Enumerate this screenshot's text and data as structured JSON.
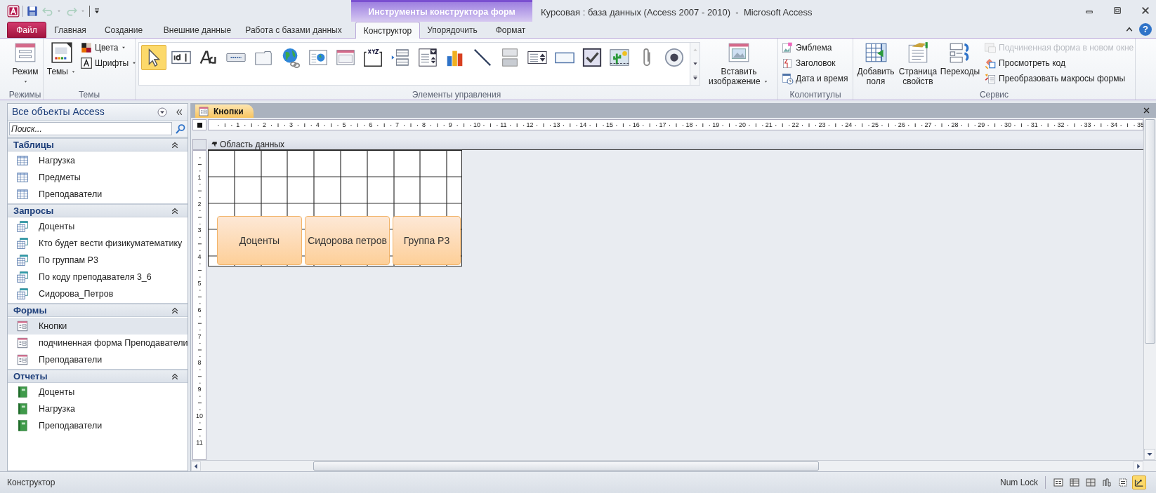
{
  "window": {
    "title": "Курсовая : база данных (Access 2007 - 2010)  -  Microsoft Access",
    "context_title": "Инструменты конструктора форм"
  },
  "quick_access": [
    {
      "disabled": false
    },
    {
      "disabled": true
    },
    {
      "disabled": true
    }
  ],
  "help": "?",
  "ribbon_tabs": [
    {
      "label": "Файл",
      "kind": "file",
      "selected": false
    },
    {
      "label": "Главная",
      "kind": "tab",
      "selected": false
    },
    {
      "label": "Создание",
      "kind": "tab",
      "selected": false
    },
    {
      "label": "Внешние данные",
      "kind": "tab",
      "selected": false
    },
    {
      "label": "Работа с базами данных",
      "kind": "tab",
      "selected": false
    },
    {
      "label": "Конструктор",
      "kind": "tab",
      "selected": true
    },
    {
      "label": "Упорядочить",
      "kind": "tab",
      "selected": false
    },
    {
      "label": "Формат",
      "kind": "tab",
      "selected": false
    }
  ],
  "ribbon_groups": [
    {
      "label": "Режимы",
      "large": [
        {
          "label": "Режим",
          "dropdown": true
        }
      ]
    },
    {
      "label": "Темы",
      "large": [
        {
          "label": "Темы",
          "dropdown": true
        }
      ],
      "small": [
        {
          "label": "Цвета",
          "dropdown": true,
          "disabled": false
        },
        {
          "label": "Шрифты",
          "dropdown": true,
          "disabled": false
        }
      ]
    },
    {
      "label": "Элементы управления",
      "tools": [
        {
          "selected": true
        },
        {
          "selected": false
        },
        {
          "selected": false
        },
        {
          "selected": false
        },
        {
          "selected": false
        },
        {
          "selected": false
        },
        {
          "selected": false
        },
        {
          "selected": false
        },
        {
          "selected": false
        },
        {
          "selected": false
        },
        {
          "selected": false
        },
        {
          "selected": false
        },
        {
          "selected": false
        },
        {
          "selected": false
        },
        {
          "selected": false
        },
        {
          "selected": false
        },
        {
          "selected": false
        },
        {
          "selected": false
        },
        {
          "selected": false
        },
        {
          "selected": false
        }
      ],
      "large": [
        {
          "label": "Вставить изображение",
          "dropdown": true
        }
      ]
    },
    {
      "label": "Колонтитулы",
      "small": [
        {
          "label": "Эмблема",
          "dropdown": false,
          "disabled": false
        },
        {
          "label": "Заголовок",
          "dropdown": false,
          "disabled": false
        },
        {
          "label": "Дата и время",
          "dropdown": false,
          "disabled": false
        }
      ]
    },
    {
      "label": "Сервис",
      "large": [
        {
          "label": "Добавить поля",
          "dropdown": false
        },
        {
          "label": "Страница свойств",
          "dropdown": false
        },
        {
          "label": "Переходы",
          "dropdown": false
        }
      ],
      "small": [
        {
          "label": "Подчиненная форма в новом окне",
          "dropdown": false,
          "disabled": true
        },
        {
          "label": "Просмотреть код",
          "dropdown": false,
          "disabled": false
        },
        {
          "label": "Преобразовать макросы формы",
          "dropdown": false,
          "disabled": false
        }
      ]
    }
  ],
  "nav": {
    "title": "Все объекты Access",
    "search_placeholder": "Поиск...",
    "groups": [
      {
        "label": "Таблицы",
        "expanded": true,
        "items": [
          {
            "label": "Нагрузка",
            "kind": "table",
            "selected": false
          },
          {
            "label": "Предметы",
            "kind": "table",
            "selected": false
          },
          {
            "label": "Преподаватели",
            "kind": "table",
            "selected": false
          }
        ]
      },
      {
        "label": "Запросы",
        "expanded": true,
        "items": [
          {
            "label": "Доценты",
            "kind": "query",
            "selected": false
          },
          {
            "label": "Кто будет вести физикуматематику",
            "kind": "query",
            "selected": false
          },
          {
            "label": "По группам Р3",
            "kind": "query",
            "selected": false
          },
          {
            "label": "По коду преподавателя 3_6",
            "kind": "query",
            "selected": false
          },
          {
            "label": "Сидорова_Петров",
            "kind": "query",
            "selected": false
          }
        ]
      },
      {
        "label": "Формы",
        "expanded": true,
        "items": [
          {
            "label": "Кнопки",
            "kind": "form",
            "selected": true
          },
          {
            "label": "подчиненная форма Преподаватели",
            "kind": "form",
            "selected": false
          },
          {
            "label": "Преподаватели",
            "kind": "form",
            "selected": false
          }
        ]
      },
      {
        "label": "Отчеты",
        "expanded": true,
        "items": [
          {
            "label": "Доценты",
            "kind": "report",
            "selected": false
          },
          {
            "label": "Нагрузка",
            "kind": "report",
            "selected": false
          },
          {
            "label": "Преподаватели",
            "kind": "report",
            "selected": false
          }
        ]
      }
    ]
  },
  "document_tabs": [
    {
      "label": "Кнопки",
      "selected": true
    }
  ],
  "ruler": {
    "horizontal": [
      "1",
      "2",
      "3",
      "4",
      "5",
      "6",
      "7",
      "8",
      "9",
      "10",
      "11",
      "12",
      "13",
      "14",
      "15",
      "16",
      "17",
      "18",
      "19",
      "20",
      "21",
      "22",
      "23",
      "24",
      "25",
      "26",
      "27",
      "28",
      "29",
      "30",
      "31",
      "32",
      "33",
      "34",
      "35"
    ],
    "vertical": [
      "1",
      "2",
      "3",
      "4",
      "5",
      "6",
      "7",
      "8",
      "9",
      "10",
      "11"
    ]
  },
  "form": {
    "section": "Область данных",
    "buttons": [
      {
        "label": "Доценты"
      },
      {
        "label": "Сидорова петров"
      },
      {
        "label": "Группа Р3"
      }
    ]
  },
  "status_bar": {
    "text": "Конструктор",
    "num_lock": "Num Lock",
    "views": [
      {
        "selected": false
      },
      {
        "selected": false
      },
      {
        "selected": false
      },
      {
        "selected": false
      },
      {
        "selected": false
      },
      {
        "selected": true
      }
    ]
  }
}
